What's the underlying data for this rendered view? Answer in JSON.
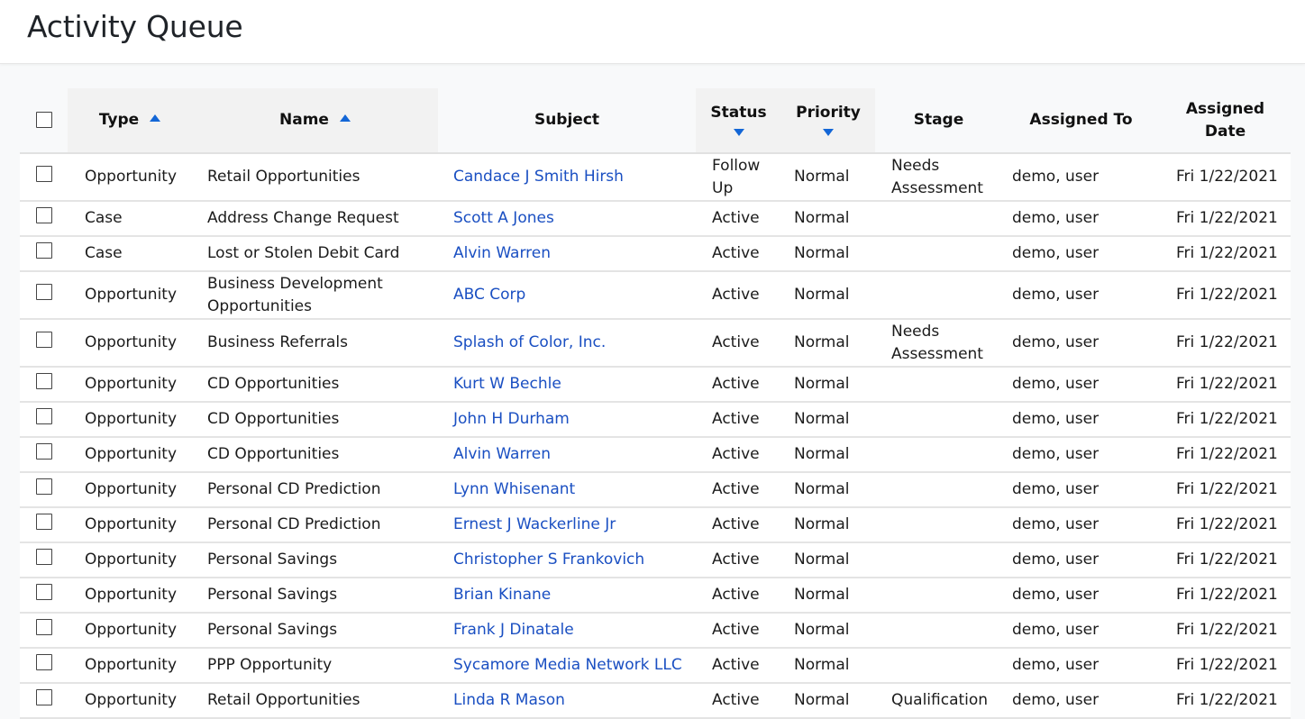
{
  "page": {
    "title": "Activity Queue"
  },
  "colors": {
    "accent": "#1366d6",
    "link": "#1a4fc2"
  },
  "table": {
    "columns": [
      {
        "key": "select",
        "label": "",
        "sort": "none"
      },
      {
        "key": "type",
        "label": "Type",
        "sort": "ascending"
      },
      {
        "key": "name",
        "label": "Name",
        "sort": "ascending"
      },
      {
        "key": "subject",
        "label": "Subject",
        "sort": "none"
      },
      {
        "key": "status",
        "label": "Status",
        "sort": "descending"
      },
      {
        "key": "priority",
        "label": "Priority",
        "sort": "descending"
      },
      {
        "key": "stage",
        "label": "Stage",
        "sort": "none"
      },
      {
        "key": "assigned_to",
        "label": "Assigned To",
        "sort": "none"
      },
      {
        "key": "assigned_date",
        "label": "Assigned Date",
        "sort": "none"
      }
    ],
    "select_all_checked": false,
    "rows": [
      {
        "checked": false,
        "type": "Opportunity",
        "name": "Retail Opportunities",
        "subject": "Candace J Smith Hirsh",
        "status": "Follow Up",
        "priority": "Normal",
        "stage": "Needs Assessment",
        "assigned_to": "demo, user",
        "assigned_date": "Fri 1/22/2021"
      },
      {
        "checked": false,
        "type": "Case",
        "name": "Address Change Request",
        "subject": "Scott A Jones",
        "status": "Active",
        "priority": "Normal",
        "stage": "",
        "assigned_to": "demo, user",
        "assigned_date": "Fri 1/22/2021"
      },
      {
        "checked": false,
        "type": "Case",
        "name": "Lost or Stolen Debit Card",
        "subject": "Alvin Warren",
        "status": "Active",
        "priority": "Normal",
        "stage": "",
        "assigned_to": "demo, user",
        "assigned_date": "Fri 1/22/2021"
      },
      {
        "checked": false,
        "type": "Opportunity",
        "name": "Business Development Opportunities",
        "subject": "ABC Corp",
        "status": "Active",
        "priority": "Normal",
        "stage": "",
        "assigned_to": "demo, user",
        "assigned_date": "Fri 1/22/2021"
      },
      {
        "checked": false,
        "type": "Opportunity",
        "name": "Business Referrals",
        "subject": "Splash of Color, Inc.",
        "status": "Active",
        "priority": "Normal",
        "stage": "Needs Assessment",
        "assigned_to": "demo, user",
        "assigned_date": "Fri 1/22/2021"
      },
      {
        "checked": false,
        "type": "Opportunity",
        "name": "CD Opportunities",
        "subject": "Kurt W Bechle",
        "status": "Active",
        "priority": "Normal",
        "stage": "",
        "assigned_to": "demo, user",
        "assigned_date": "Fri 1/22/2021"
      },
      {
        "checked": false,
        "type": "Opportunity",
        "name": "CD Opportunities",
        "subject": "John H Durham",
        "status": "Active",
        "priority": "Normal",
        "stage": "",
        "assigned_to": "demo, user",
        "assigned_date": "Fri 1/22/2021"
      },
      {
        "checked": false,
        "type": "Opportunity",
        "name": "CD Opportunities",
        "subject": "Alvin Warren",
        "status": "Active",
        "priority": "Normal",
        "stage": "",
        "assigned_to": "demo, user",
        "assigned_date": "Fri 1/22/2021"
      },
      {
        "checked": false,
        "type": "Opportunity",
        "name": "Personal CD Prediction",
        "subject": "Lynn Whisenant",
        "status": "Active",
        "priority": "Normal",
        "stage": "",
        "assigned_to": "demo, user",
        "assigned_date": "Fri 1/22/2021"
      },
      {
        "checked": false,
        "type": "Opportunity",
        "name": "Personal CD Prediction",
        "subject": "Ernest J Wackerline Jr",
        "status": "Active",
        "priority": "Normal",
        "stage": "",
        "assigned_to": "demo, user",
        "assigned_date": "Fri 1/22/2021"
      },
      {
        "checked": false,
        "type": "Opportunity",
        "name": "Personal Savings",
        "subject": "Christopher S Frankovich",
        "status": "Active",
        "priority": "Normal",
        "stage": "",
        "assigned_to": "demo, user",
        "assigned_date": "Fri 1/22/2021"
      },
      {
        "checked": false,
        "type": "Opportunity",
        "name": "Personal Savings",
        "subject": "Brian Kinane",
        "status": "Active",
        "priority": "Normal",
        "stage": "",
        "assigned_to": "demo, user",
        "assigned_date": "Fri 1/22/2021"
      },
      {
        "checked": false,
        "type": "Opportunity",
        "name": "Personal Savings",
        "subject": "Frank J Dinatale",
        "status": "Active",
        "priority": "Normal",
        "stage": "",
        "assigned_to": "demo, user",
        "assigned_date": "Fri 1/22/2021"
      },
      {
        "checked": false,
        "type": "Opportunity",
        "name": "PPP Opportunity",
        "subject": "Sycamore Media Network LLC",
        "status": "Active",
        "priority": "Normal",
        "stage": "",
        "assigned_to": "demo, user",
        "assigned_date": "Fri 1/22/2021"
      },
      {
        "checked": false,
        "type": "Opportunity",
        "name": "Retail Opportunities",
        "subject": "Linda R Mason",
        "status": "Active",
        "priority": "Normal",
        "stage": "Qualification",
        "assigned_to": "demo, user",
        "assigned_date": "Fri 1/22/2021"
      }
    ]
  }
}
